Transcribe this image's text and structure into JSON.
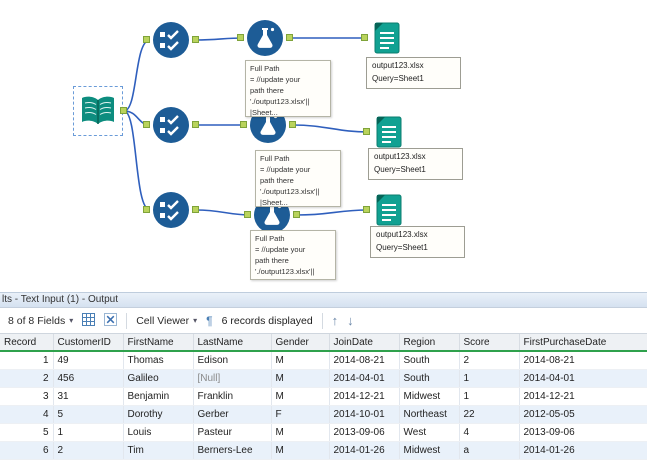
{
  "colors": {
    "tool_blue": "#1d5c96",
    "tool_teal": "#0d8d7f",
    "anchor_green": "#b9d35c",
    "wire_blue": "#2f5fbd",
    "header_underline_green": "#2fa14c",
    "row_stripe": "#e9f1fa"
  },
  "canvas": {
    "annotations": [
      {
        "text": "Full Path\n= //update your\npath there\n'./output123.xlsx'||\n|Sheet..."
      },
      {
        "text": "Full Path\n= //update your\npath there\n'./output123.xlsx'||\n|Sheet..."
      },
      {
        "text": "Full Path\n= //update your\npath there\n'./output123.xlsx'||"
      }
    ],
    "output_labels": [
      {
        "text": "output123.xlsx\nQuery=Sheet1"
      },
      {
        "text": "output123.xlsx\nQuery=Sheet1"
      },
      {
        "text": "output123.xlsx\nQuery=Sheet1"
      }
    ]
  },
  "results_panel": {
    "title": "lts - Text Input (1) - Output",
    "toolbar": {
      "fields_label": "8 of 8 Fields",
      "cell_viewer_label": "Cell Viewer",
      "records_label": "6 records displayed"
    },
    "table": {
      "columns": [
        "Record",
        "CustomerID",
        "FirstName",
        "LastName",
        "Gender",
        "JoinDate",
        "Region",
        "Score",
        "FirstPurchaseDate"
      ],
      "rows": [
        [
          "1",
          "49",
          "Thomas",
          "Edison",
          "M",
          "2014-08-21",
          "South",
          "2",
          "2014-08-21"
        ],
        [
          "2",
          "456",
          "Galileo",
          "[Null]",
          "M",
          "2014-04-01",
          "South",
          "1",
          "2014-04-01"
        ],
        [
          "3",
          "31",
          "Benjamin",
          "Franklin",
          "M",
          "2014-12-21",
          "Midwest",
          "1",
          "2014-12-21"
        ],
        [
          "4",
          "5",
          "Dorothy",
          "Gerber",
          "F",
          "2014-10-01",
          "Northeast",
          "22",
          "2012-05-05"
        ],
        [
          "5",
          "1",
          "Louis",
          "Pasteur",
          "M",
          "2013-09-06",
          "West",
          "4",
          "2013-09-06"
        ],
        [
          "6",
          "2",
          "Tim",
          "Berners-Lee",
          "M",
          "2014-01-26",
          "Midwest",
          "a",
          "2014-01-26"
        ]
      ]
    }
  }
}
